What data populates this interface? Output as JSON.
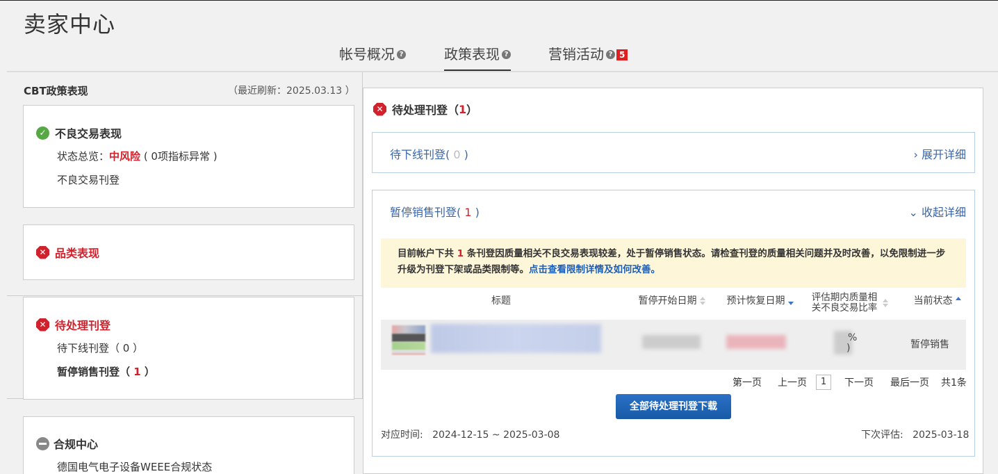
{
  "app": {
    "title": "卖家中心"
  },
  "tabs": [
    {
      "label": "帐号概况",
      "help": "?"
    },
    {
      "label": "政策表现",
      "help": "?",
      "active": true
    },
    {
      "label": "营销活动",
      "help": "?",
      "badge": "5"
    }
  ],
  "left": {
    "title": "CBT政策表现",
    "refresh": "（最近刷新：2025.03.13 ）",
    "bad_trade": {
      "title": "不良交易表现",
      "status_label": "状态总览：",
      "status_value": "中风险",
      "status_note": "( 0项指标异常 )",
      "link": "不良交易刊登"
    },
    "category": {
      "title": "品类表现"
    },
    "pending": {
      "title": "待处理刊登",
      "offline": "待下线刊登（ 0 ）",
      "suspend_label": "暂停销售刊登（ ",
      "suspend_count": "1",
      "suspend_close": " ）"
    },
    "compliance": {
      "title": "合规中心",
      "item": "德国电气电子设备WEEE合规状态"
    }
  },
  "right": {
    "title": "待处理刊登",
    "title_open": "（ ",
    "title_count": "1",
    "title_close": " ）",
    "offline": {
      "label": "待下线刊登(",
      "count": " 0 ",
      "close": ")",
      "toggle": "展开详细",
      "toggle_icon": "›"
    },
    "suspend": {
      "label": "暂停销售刊登(",
      "count": " 1 ",
      "close": ")",
      "toggle": "收起详细",
      "toggle_icon": "⌄"
    },
    "notice": {
      "text1": "目前帐户下共 ",
      "count": "1",
      "text2": " 条刊登因质量相关不良交易表现较差，处于暂停销售状态。请检查刊登的质量相关问题并及时改善，以免限制进一步升级为刊登下架或品类限制等。",
      "link": "点击查看限制详情及如何改善。"
    },
    "table": {
      "headers": [
        "标题",
        "暂停开始日期",
        "预计恢复日期",
        "评估期内质量相关不良交易比率",
        "当前状态"
      ],
      "row": {
        "ratio_visible": "%",
        "ratio_close": ")",
        "status": "暂停销售"
      }
    },
    "pager": {
      "first": "第一页",
      "prev": "上一页",
      "current": "1",
      "next": "下一页",
      "last": "最后一页",
      "total": "共1条"
    },
    "download": "全部待处理刊登下载",
    "period_label": "对应时间:",
    "period": "2024-12-15 ~ 2025-03-08",
    "next_eval_label": "下次评估:",
    "next_eval": "2025-03-18"
  }
}
